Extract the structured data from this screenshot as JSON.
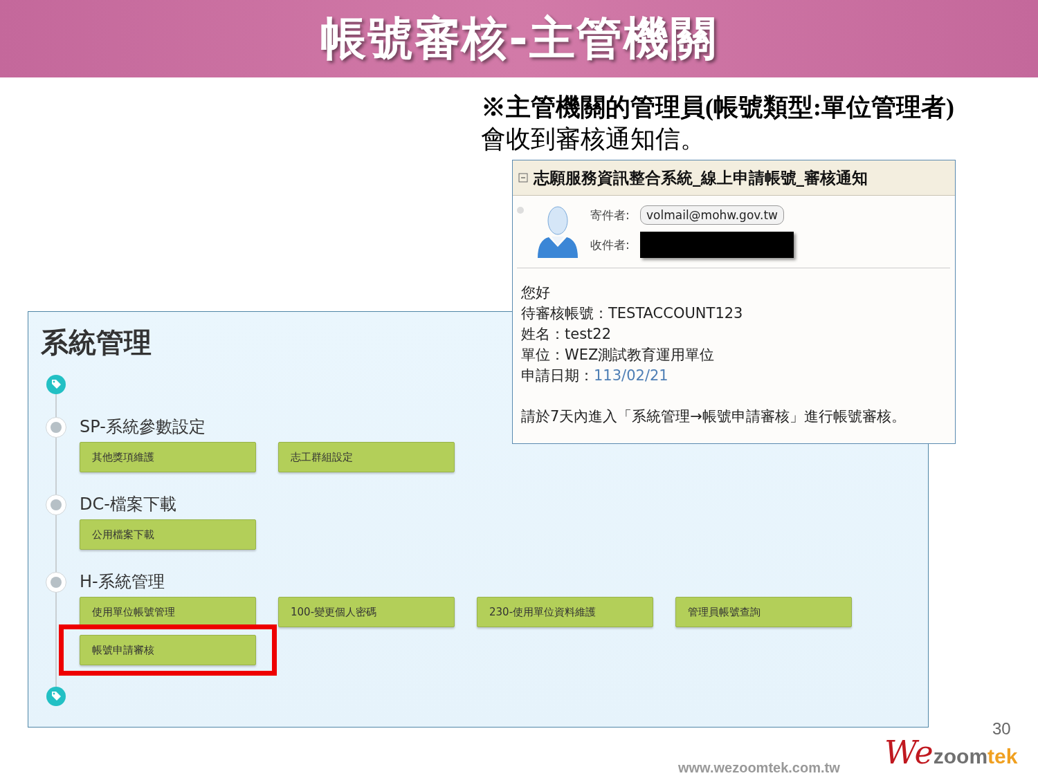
{
  "slide": {
    "title": "帳號審核-主管機關",
    "page_number": "30",
    "footer_url": "www.wezoomtek.com.tw",
    "logo": {
      "script": "We",
      "word_1": "zoom",
      "word_2": "tek"
    }
  },
  "note": [
    "※主管機關的管理員(帳號類型:單位管理者)",
    "會收到審核通知信。"
  ],
  "email": {
    "subject": "志願服務資訊整合系統_線上申請帳號_審核通知",
    "sender_label": "寄件者:",
    "sender": "volmail@mohw.gov.tw",
    "recipient_label": "收件者:",
    "recipient_redacted": true,
    "body": [
      {
        "kind": "text",
        "text": "您好"
      },
      {
        "kind": "field",
        "label": "待審核帳號：",
        "value": "TESTACCOUNT123"
      },
      {
        "kind": "field",
        "label": "姓名：",
        "value": "test22"
      },
      {
        "kind": "field",
        "label": "單位：",
        "value": "WEZ測試教育運用單位"
      },
      {
        "kind": "date",
        "label": "申請日期：",
        "value": "113/02/21"
      },
      {
        "kind": "gap"
      },
      {
        "kind": "text",
        "text": "請於7天內進入「系統管理→帳號申請審核」進行帳號審核。"
      }
    ]
  },
  "panel": {
    "title": "系統管理",
    "groups": [
      {
        "name": "SP-系統參數設定",
        "items": [
          {
            "label": "其他獎項維護",
            "highlighted": false
          },
          {
            "label": "志工群組設定",
            "highlighted": false
          }
        ]
      },
      {
        "name": "DC-檔案下載",
        "items": [
          {
            "label": "公用檔案下載",
            "highlighted": false
          }
        ]
      },
      {
        "name": "H-系統管理",
        "items": [
          {
            "label": "使用單位帳號管理",
            "highlighted": false
          },
          {
            "label": "100-變更個人密碼",
            "highlighted": false
          },
          {
            "label": "230-使用單位資料維護",
            "highlighted": false
          },
          {
            "label": "管理員帳號查詢",
            "highlighted": false
          },
          {
            "label": "帳號申請審核",
            "highlighted": true
          }
        ]
      }
    ]
  }
}
